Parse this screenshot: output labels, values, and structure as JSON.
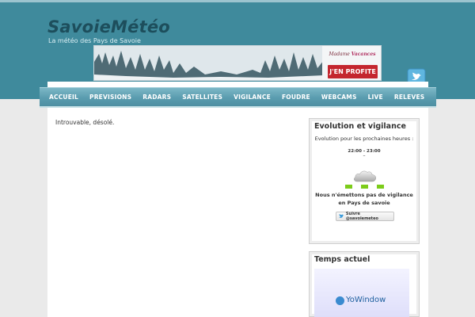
{
  "site": {
    "title": "SavoieMétéo",
    "tagline": "La météo des Pays de Savoie"
  },
  "banner": {
    "brand_prefix": "Madame",
    "brand_accent": "Vacances",
    "cta": "J'EN PROFITE"
  },
  "nav": {
    "items": [
      "ACCUEIL",
      "PREVISIONS",
      "RADARS",
      "SATELLITES",
      "VIGILANCE",
      "FOUDRE",
      "WEBCAMS",
      "LIVE",
      "RELEVES"
    ]
  },
  "content": {
    "message": "Introuvable, désolé."
  },
  "sidebar": {
    "vigilance_widget": {
      "title": "Evolution et vigilance",
      "subtitle": "Evolution pour les prochaines heures :",
      "time_range": "22:00 - 23:00",
      "dash": "–",
      "message": "Nous n'émettons pas de vigilance en Pays de savoie",
      "follow_label": "Suivre @savoiemeteo",
      "level_color": "#7ccc1a"
    },
    "weather_widget": {
      "title": "Temps actuel",
      "yowindow_label": "YoWindow"
    }
  },
  "colors": {
    "header": "#3f8a9c",
    "nav": "#5a9caf",
    "title": "#1d4e5c",
    "cta": "#c4262e"
  },
  "icons": [
    "twitter-icon",
    "cloud-icon",
    "twitter-bird-icon",
    "yowindow-logo-icon"
  ]
}
